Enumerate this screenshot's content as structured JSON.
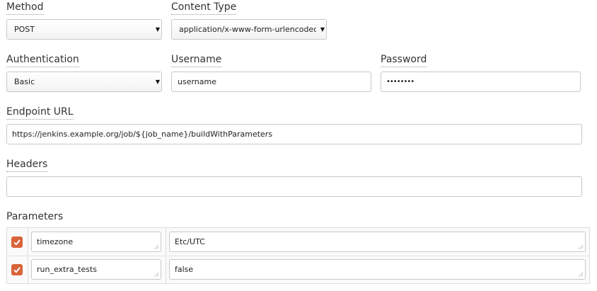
{
  "method": {
    "label": "Method",
    "value": "POST"
  },
  "content_type": {
    "label": "Content Type",
    "value": "application/x-www-form-urlencoded"
  },
  "authentication": {
    "label": "Authentication",
    "value": "Basic"
  },
  "username": {
    "label": "Username",
    "value": "username"
  },
  "password": {
    "label": "Password",
    "value": "••••••••"
  },
  "endpoint": {
    "label": "Endpoint URL",
    "value": "https://jenkins.example.org/job/${job_name}/buildWithParameters"
  },
  "headers": {
    "label": "Headers",
    "value": ""
  },
  "parameters": {
    "label": "Parameters",
    "rows": [
      {
        "checked": true,
        "key": "timezone",
        "value": "Etc/UTC"
      },
      {
        "checked": true,
        "key": "run_extra_tests",
        "value": "false"
      }
    ]
  },
  "colors": {
    "checkbox": "#d9643a",
    "border": "#c8c8c8"
  },
  "icons": {
    "dropdown": "caret-down-icon",
    "check": "check-icon",
    "resize": "resize-grip-icon"
  }
}
